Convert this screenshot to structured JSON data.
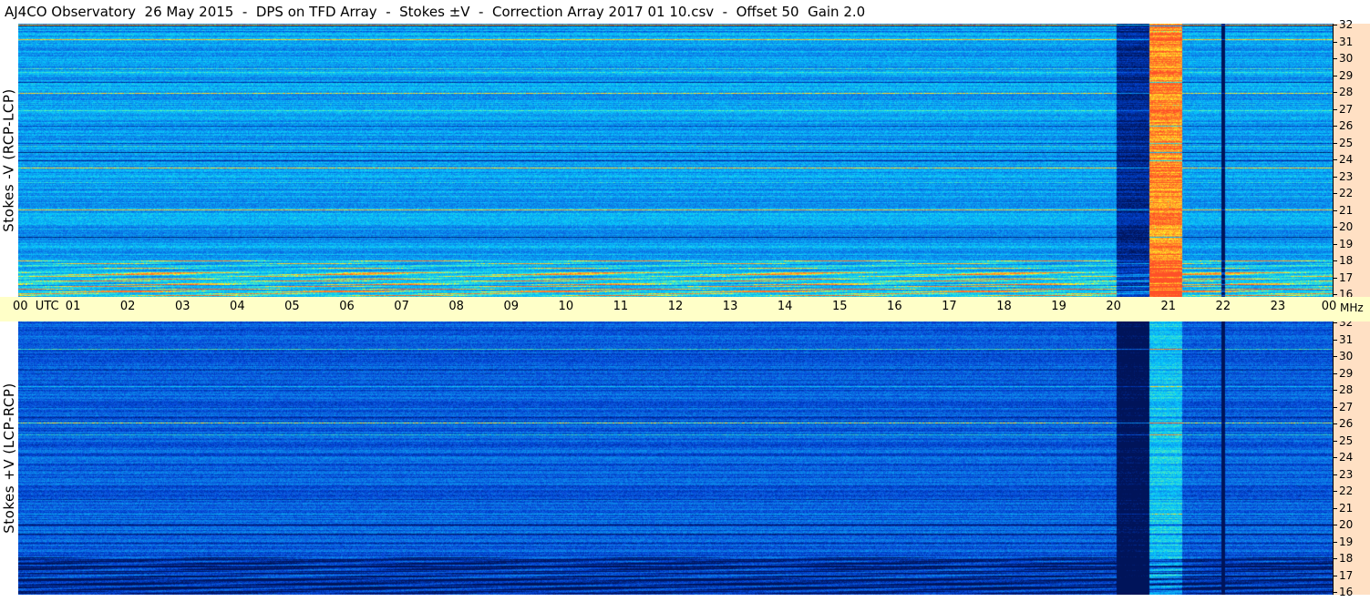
{
  "title": "AJ4CO Observatory  26 May 2015  -  DPS on TFD Array  -  Stokes ±V  -  Correction Array 2017 01 10.csv  -  Offset 50  Gain 2.0",
  "panels": [
    {
      "label": "Stokes -V (RCP-LCP)"
    },
    {
      "label": "Stokes +V (LCP-RCP)"
    }
  ],
  "utc_ticks": [
    "00  UTC",
    "01",
    "02",
    "03",
    "04",
    "05",
    "06",
    "07",
    "08",
    "09",
    "10",
    "11",
    "12",
    "13",
    "14",
    "15",
    "16",
    "17",
    "18",
    "19",
    "20",
    "21",
    "22",
    "23",
    "00"
  ],
  "mhz_ticks": [
    "32",
    "31",
    "30",
    "29",
    "28",
    "27",
    "26",
    "25",
    "24",
    "23",
    "22",
    "21",
    "20",
    "19",
    "18",
    "17",
    "16"
  ],
  "mhz_unit": "MHz",
  "colors": {
    "axis_strip": "#ffffc8",
    "mhz_column": "#ffe0c4",
    "spectrogram_upper_base": "#1a8cff",
    "spectrogram_lower_base": "#1a55e0"
  }
}
